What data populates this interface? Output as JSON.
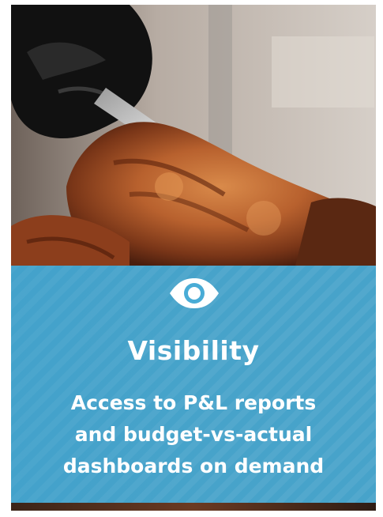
{
  "card": {
    "image_icon": "grilled-meat-photo",
    "icon": "eye-icon",
    "title": "Visibility",
    "description_lines": [
      "Access to P&L reports",
      "and budget-vs-actual",
      "dashboards on demand"
    ]
  },
  "colors": {
    "panel": "#49acd6",
    "text": "#ffffff"
  }
}
